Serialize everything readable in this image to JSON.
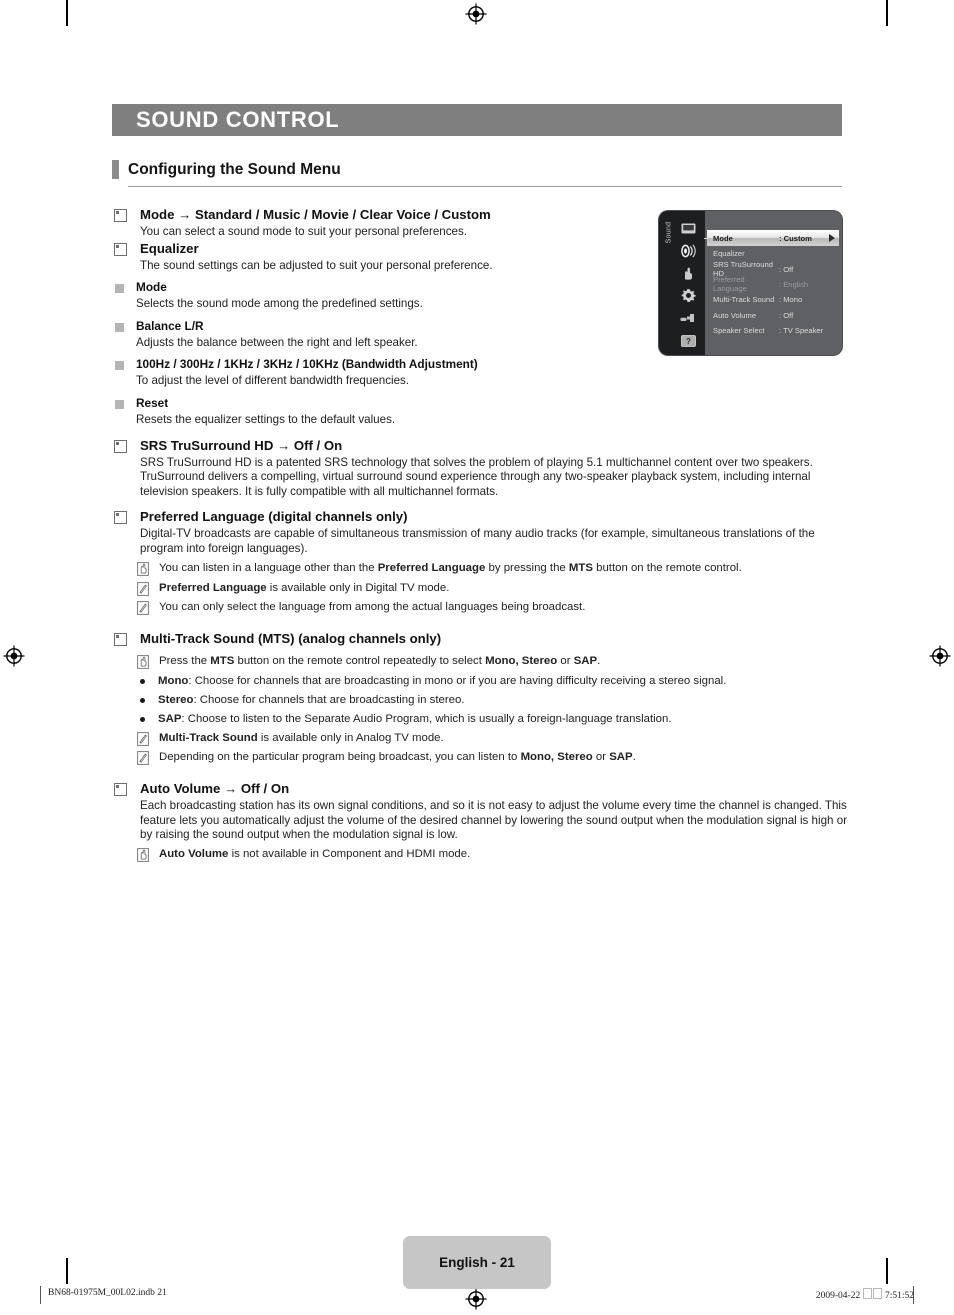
{
  "chapter": {
    "title": "SOUND CONTROL"
  },
  "section": {
    "title": "Configuring the Sound Menu"
  },
  "content": {
    "mode": {
      "heading": "Mode → Standard / Music / Movie / Clear Voice / Custom",
      "body": "You can select a sound mode to suit your personal preferences."
    },
    "equalizer": {
      "heading": "Equalizer",
      "body": "The sound settings can be adjusted to suit your personal preference.",
      "subitems": [
        {
          "label": "Mode",
          "body": "Selects the sound mode among the predefined settings."
        },
        {
          "label": "Balance L/R",
          "body": "Adjusts the balance between the right and left speaker."
        },
        {
          "label": "100Hz / 300Hz / 1KHz / 3KHz / 10KHz (Bandwidth Adjustment)",
          "body": "To adjust the level of different bandwidth frequencies."
        },
        {
          "label": "Reset",
          "body": "Resets the equalizer settings to the default values."
        }
      ]
    },
    "srs": {
      "heading": "SRS TruSurround HD → Off / On",
      "body": "SRS TruSurround HD is a patented SRS technology that solves the problem of playing 5.1 multichannel content over two speakers. TruSurround delivers a compelling, virtual surround sound experience through any two-speaker playback system, including internal television speakers. It is fully compatible with all multichannel formats."
    },
    "preferred_language": {
      "heading": "Preferred Language (digital channels only)",
      "body": "Digital-TV broadcasts are capable of simultaneous transmission of many audio tracks (for example, simultaneous translations of the program into foreign languages).",
      "notes": [
        {
          "icon": "hand-press-icon",
          "html": "You can listen in a language other than the <b>Preferred Language</b> by pressing the <b>MTS</b> button on the remote control."
        },
        {
          "icon": "note-pencil-icon",
          "html": "<b>Preferred Language</b> is available only in Digital TV mode."
        },
        {
          "icon": "note-pencil-icon",
          "html": "You can only select the language from among the actual languages being broadcast."
        }
      ]
    },
    "mts": {
      "heading": "Multi-Track Sound (MTS) (analog channels only)",
      "notes": [
        {
          "icon": "hand-press-icon",
          "html": "Press the <b>MTS</b> button on the remote control repeatedly to select <b>Mono, Stereo</b> or <b>SAP</b>."
        }
      ],
      "bullets": [
        {
          "html": "<b>Mono</b>: Choose for channels that are broadcasting in mono or if you are having difficulty receiving a stereo signal."
        },
        {
          "html": "<b>Stereo</b>: Choose for channels that are broadcasting in stereo."
        },
        {
          "html": "<b>SAP</b>: Choose to listen to the Separate Audio Program, which is usually a foreign-language translation."
        }
      ],
      "notes2": [
        {
          "icon": "note-pencil-icon",
          "html": "<b>Multi-Track Sound</b> is available only in Analog TV mode."
        },
        {
          "icon": "note-pencil-icon",
          "html": "Depending on the particular program being broadcast, you can listen to <b>Mono, Stereo</b> or <b>SAP</b>."
        }
      ]
    },
    "auto_volume": {
      "heading": "Auto Volume → Off / On",
      "body": "Each broadcasting station has its own signal conditions, and so it is not easy to adjust the volume every time the channel is changed. This feature lets you automatically adjust the volume of the desired channel by lowering the sound output when the modulation signal is high or by raising the sound output when the modulation signal is low.",
      "notes": [
        {
          "icon": "hand-press-icon",
          "html": "<b>Auto Volume</b> is not available in Component and HDMI mode."
        }
      ]
    }
  },
  "osd": {
    "rail_label": "Sound",
    "rail_icons": [
      {
        "name": "picture-icon"
      },
      {
        "name": "sound-speaker-icon",
        "selected": true
      },
      {
        "name": "channel-hand-icon"
      },
      {
        "name": "setup-gear-icon"
      },
      {
        "name": "input-plug-icon"
      },
      {
        "name": "support-help-icon"
      }
    ],
    "rows": [
      {
        "label": "Mode",
        "value": ": Custom",
        "state": "selected"
      },
      {
        "label": "Equalizer",
        "value": "",
        "state": "normal"
      },
      {
        "label": "SRS TruSurround HD",
        "value": ": Off",
        "state": "normal"
      },
      {
        "label": "Preferred Language",
        "value": ": English",
        "state": "dimmed"
      },
      {
        "label": "Multi-Track Sound",
        "value": ": Mono",
        "state": "normal"
      },
      {
        "label": "Auto Volume",
        "value": ": Off",
        "state": "normal"
      },
      {
        "label": "Speaker Select",
        "value": ": TV Speaker",
        "state": "normal"
      }
    ]
  },
  "footer": {
    "page_label": "English - 21",
    "file_ref": "BN68-01975M_00L02.indb   21",
    "date": "2009-04-22",
    "time": "7:51:52"
  },
  "colors": {
    "banner": "#7f7f7f",
    "page_tag": "#c6c6c6",
    "osd_bg": "#5e6063",
    "osd_rail": "#1d1e20"
  }
}
